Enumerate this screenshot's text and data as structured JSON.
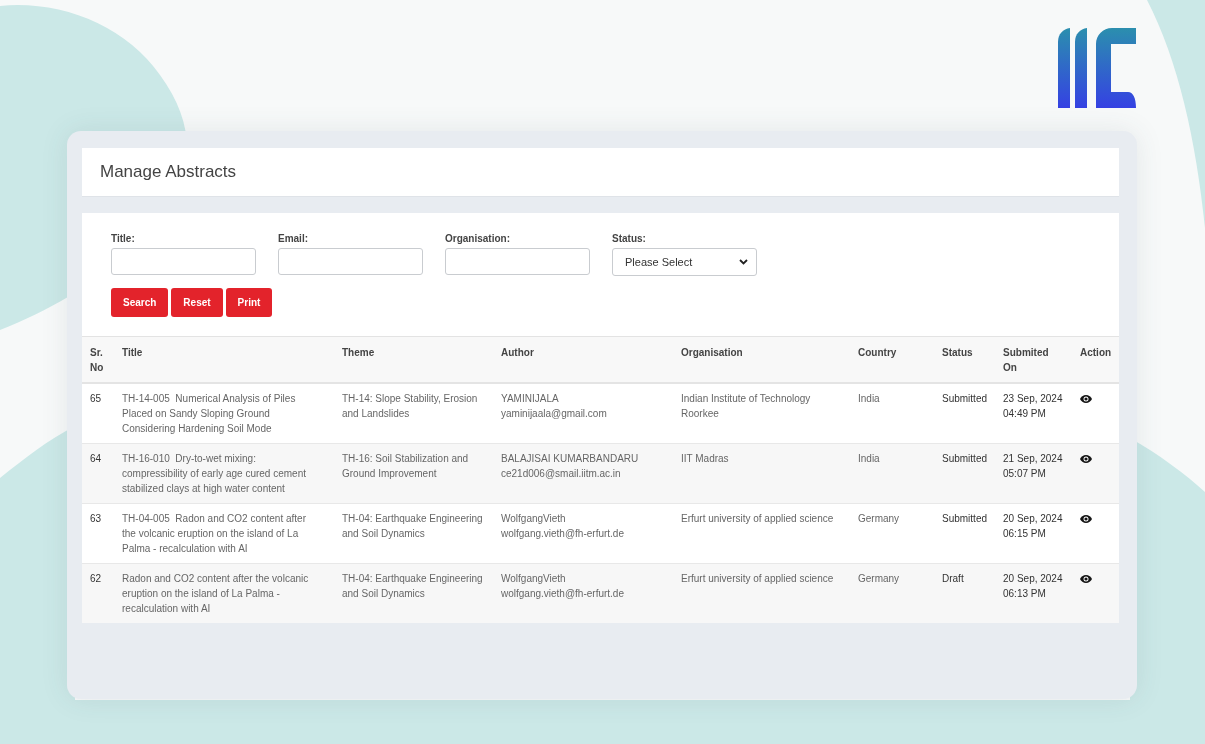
{
  "header": {
    "title": "Manage Abstracts"
  },
  "filters": [
    {
      "kind": "text",
      "label": "Title:"
    },
    {
      "kind": "text",
      "label": "Email:"
    },
    {
      "kind": "text",
      "label": "Organisation:"
    },
    {
      "kind": "select",
      "label": "Status:",
      "value": "Please Select"
    }
  ],
  "buttons": [
    "Search",
    "Reset",
    "Print"
  ],
  "table": {
    "columns": [
      "Sr. No",
      "Title",
      "Theme",
      "Author",
      "Organisation",
      "Country",
      "Status",
      "Submited On",
      "Action"
    ],
    "rows": [
      {
        "sr_no": "65",
        "title": "TH-14-005  Numerical Analysis of Piles Placed on Sandy Sloping Ground Considering Hardening Soil Mode",
        "theme": "TH-14: Slope Stability, Erosion and Landslides",
        "author": {
          "name": "YAMINIJALA",
          "email": "yaminijaala@gmail.com"
        },
        "organisation": "Indian Institute of Technology Roorkee",
        "country": "India",
        "status": "Submitted",
        "submitted_on": {
          "date": "23 Sep, 2024",
          "time": "04:49 PM"
        }
      },
      {
        "sr_no": "64",
        "title": "TH-16-010  Dry-to-wet mixing: compressibility of early age cured cement stabilized clays at high water content",
        "theme": "TH-16: Soil Stabilization and Ground Improvement",
        "author": {
          "name": "BALAJISAI KUMARBANDARU",
          "email": "ce21d006@smail.iitm.ac.in"
        },
        "organisation": "IIT Madras",
        "country": "India",
        "status": "Submitted",
        "submitted_on": {
          "date": "21 Sep, 2024",
          "time": "05:07 PM"
        }
      },
      {
        "sr_no": "63",
        "title": "TH-04-005  Radon and CO2 content after the volcanic eruption on the island of La Palma - recalculation with AI",
        "theme": "TH-04: Earthquake Engineering and Soil Dynamics",
        "author": {
          "name": "WolfgangVieth",
          "email": "wolfgang.vieth@fh-erfurt.de"
        },
        "organisation": "Erfurt university of applied science",
        "country": "Germany",
        "status": "Submitted",
        "submitted_on": {
          "date": "20 Sep, 2024",
          "time": "06:15 PM"
        }
      },
      {
        "sr_no": "62",
        "title": "Radon and CO2 content after the volcanic eruption on the island of La Palma - recalculation with AI",
        "theme": "TH-04: Earthquake Engineering and Soil Dynamics",
        "author": {
          "name": "WolfgangVieth",
          "email": "wolfgang.vieth@fh-erfurt.de"
        },
        "organisation": "Erfurt university of applied science",
        "country": "Germany",
        "status": "Draft",
        "submitted_on": {
          "date": "20 Sep, 2024",
          "time": "06:13 PM"
        }
      }
    ]
  }
}
